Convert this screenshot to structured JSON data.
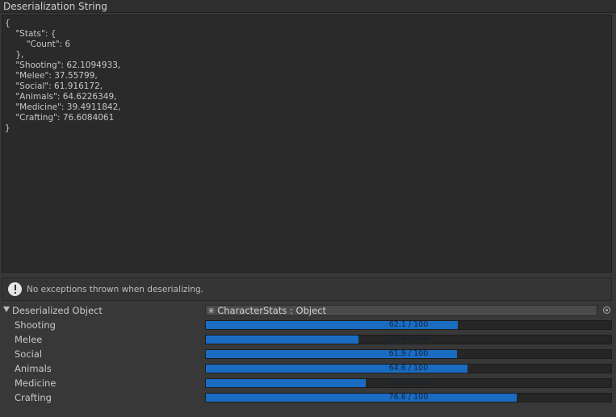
{
  "deserialization": {
    "title": "Deserialization String",
    "json_text": "{\n    \"Stats\": {\n        \"Count\": 6\n    },\n    \"Shooting\": 62.1094933,\n    \"Melee\": 37.55799,\n    \"Social\": 61.916172,\n    \"Animals\": 64.6226349,\n    \"Medicine\": 39.4911842,\n    \"Crafting\": 76.6084061\n}"
  },
  "help_box": {
    "icon": "info-icon",
    "message": "No exceptions thrown when deserializing."
  },
  "deserialized_object": {
    "label": "Deserialized Object",
    "type_icon": "asterisk-icon",
    "type_label": "CharacterStats : Object"
  },
  "colors": {
    "bar_fill": "#1a6cc2",
    "bar_background": "#262626"
  },
  "stats": [
    {
      "label": "Shooting",
      "value": 62.1,
      "max": 100,
      "text": "62.1 / 100"
    },
    {
      "label": "Melee",
      "value": 37.6,
      "max": 100,
      "text": "37.6 / 100"
    },
    {
      "label": "Social",
      "value": 61.9,
      "max": 100,
      "text": "61.9 / 100"
    },
    {
      "label": "Animals",
      "value": 64.6,
      "max": 100,
      "text": "64.6 / 100"
    },
    {
      "label": "Medicine",
      "value": 39.5,
      "max": 100,
      "text": "39.5 / 100"
    },
    {
      "label": "Crafting",
      "value": 76.6,
      "max": 100,
      "text": "76.6 / 100"
    }
  ]
}
